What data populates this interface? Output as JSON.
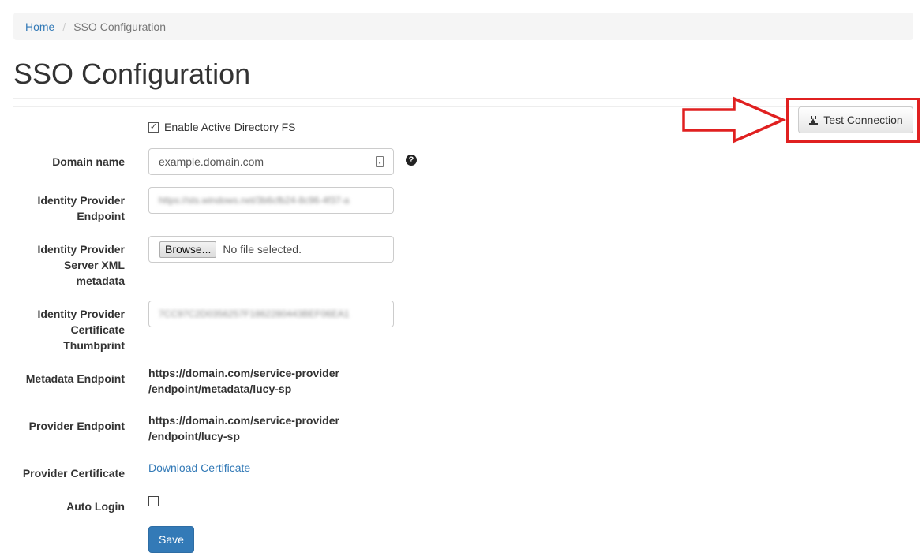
{
  "breadcrumb": {
    "home": "Home",
    "separator": "/",
    "current": "SSO Configuration"
  },
  "page": {
    "title": "SSO Configuration"
  },
  "form": {
    "enable_adfs_label": "Enable Active Directory FS",
    "enable_adfs_checked": true,
    "domain_name": {
      "label": "Domain name",
      "placeholder": "example.domain.com"
    },
    "idp_endpoint": {
      "label_line1": "Identity Provider",
      "label_line2": "Endpoint",
      "value": "https://sts.windows.net/3b6cfb24-8c96-4f37-a"
    },
    "idp_xml": {
      "label_line1": "Identity Provider",
      "label_line2": "Server XML",
      "label_line3": "metadata",
      "browse_label": "Browse...",
      "no_file_label": "No file selected."
    },
    "idp_thumbprint": {
      "label_line1": "Identity Provider",
      "label_line2": "Certificate",
      "label_line3": "Thumbprint",
      "value": "7CC97C2D0356257F1862280443BEF06EA1"
    },
    "metadata_endpoint": {
      "label": "Metadata Endpoint",
      "line1": "https://domain.com/service-provider",
      "line2": "/endpoint/metadata/lucy-sp"
    },
    "provider_endpoint": {
      "label": "Provider Endpoint",
      "line1": "https://domain.com/service-provider",
      "line2": "/endpoint/lucy-sp"
    },
    "provider_certificate": {
      "label": "Provider Certificate",
      "link": "Download Certificate"
    },
    "auto_login": {
      "label": "Auto Login",
      "checked": false
    },
    "save_label": "Save"
  },
  "toolbar": {
    "test_connection_label": "Test Connection"
  },
  "colors": {
    "link": "#337ab7",
    "primary": "#337ab7",
    "annotation": "#e02020"
  },
  "icons": {
    "help": "question-circle-icon",
    "test": "plug-icon",
    "field": "contact-card-icon"
  }
}
